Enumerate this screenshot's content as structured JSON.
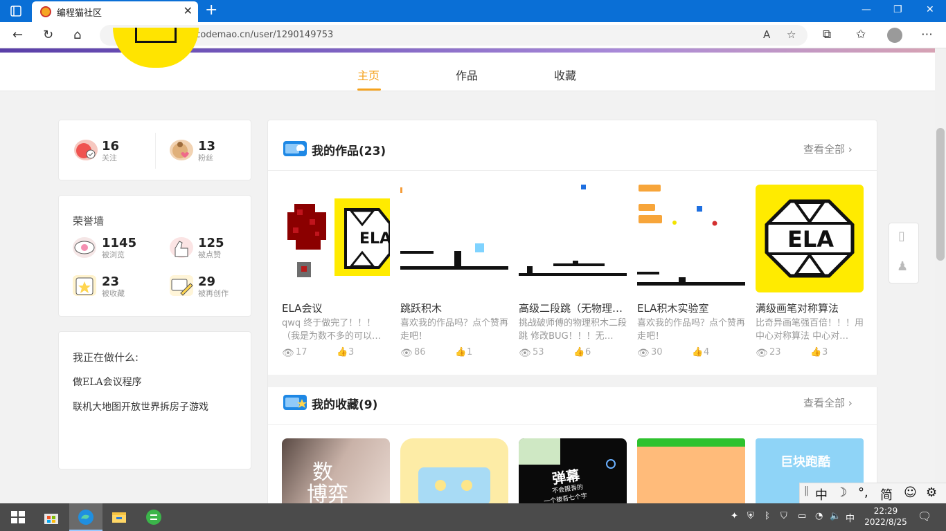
{
  "browser": {
    "tab_title": "编程猫社区",
    "tab_close": "✕",
    "new_tab": "+",
    "url": "https://shequ.codemao.cn/user/1290149753",
    "minimize": "—",
    "restore": "❐",
    "close": "✕"
  },
  "nav_tabs": [
    {
      "label": "主页",
      "active": true
    },
    {
      "label": "作品",
      "active": false
    },
    {
      "label": "收藏",
      "active": false
    }
  ],
  "follow": {
    "following_count": "16",
    "following_label": "关注",
    "fans_count": "13",
    "fans_label": "粉丝"
  },
  "honor": {
    "title": "荣誉墙",
    "views_count": "1145",
    "views_label": "被浏览",
    "likes_count": "125",
    "likes_label": "被点赞",
    "collect_count": "23",
    "collect_label": "被收藏",
    "remix_count": "29",
    "remix_label": "被再创作"
  },
  "doing": {
    "title": "我正在做什么:",
    "items": [
      "做ELA会议程序",
      "联机大地图开放世界拆房子游戏"
    ]
  },
  "works_section": {
    "title": "我的作品(23)",
    "view_all": "查看全部"
  },
  "works": [
    {
      "title": "ELA会议",
      "desc": "qwq 终于做完了！！！（我是为数不多的可以…",
      "views": "17",
      "likes": "3"
    },
    {
      "title": "跳跃积木",
      "desc": "喜欢我的作品吗？点个赞再走吧！",
      "views": "86",
      "likes": "1"
    },
    {
      "title": "高级二段跳（无物理…",
      "desc": "挑战破师傅的物理积木二段跳 修改BUG！！！无…",
      "views": "53",
      "likes": "6"
    },
    {
      "title": "ELA积木实验室",
      "desc": "喜欢我的作品吗？点个赞再走吧！",
      "views": "30",
      "likes": "4"
    },
    {
      "title": "满级画笔对称算法",
      "desc": "比奇异画笔强百倍！！！用中心对称算法 中心对…",
      "views": "23",
      "likes": "3"
    }
  ],
  "ela_logo_text": "ELA",
  "fav_section": {
    "title": "我的收藏(9)",
    "view_all": "查看全部"
  },
  "fav_thumbs": {
    "t1": "数",
    "t1b": "博弈",
    "t3a": "弹幕",
    "t3b": "不会服吾的",
    "t3c": "一个被吾七个字",
    "t5": "巨块跑酷"
  },
  "ime": {
    "mode": "中",
    "moon": "☽",
    "punct": "°,",
    "simp": "简",
    "emoji": "☺",
    "gear": "⚙"
  },
  "taskbar": {
    "tray_lang": "中",
    "time": "22:29",
    "date": "2022/8/25"
  }
}
